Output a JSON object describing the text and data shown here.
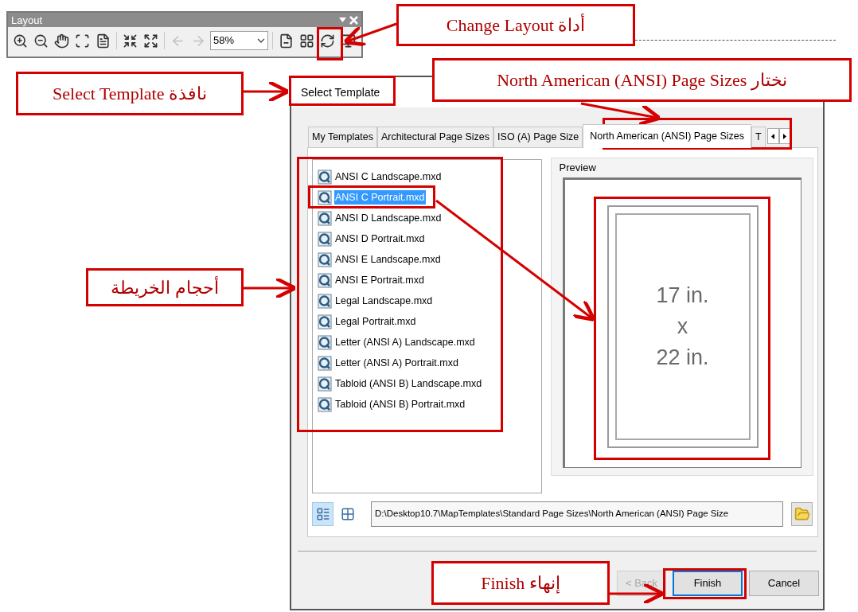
{
  "toolbar": {
    "title": "Layout",
    "zoom": "58%",
    "tool_groups": [
      [
        {
          "disabled": false
        },
        {
          "disabled": false
        },
        {
          "disabled": false
        },
        {
          "disabled": false
        },
        {
          "disabled": false
        }
      ],
      [
        {
          "disabled": false
        },
        {
          "disabled": false
        }
      ],
      [
        {
          "disabled": true
        },
        {
          "disabled": true
        }
      ],
      [
        {
          "disabled": false
        },
        {
          "disabled": false
        },
        {
          "disabled": false
        },
        {
          "disabled": false
        }
      ]
    ]
  },
  "dialog": {
    "title": "Select Template",
    "tabs": [
      {
        "label": "My Templates",
        "selected": false
      },
      {
        "label": "Architectural Page Sizes",
        "selected": false
      },
      {
        "label": "ISO (A) Page Size",
        "selected": false
      },
      {
        "label": "North American (ANSI) Page Sizes",
        "selected": true
      },
      {
        "label": "T",
        "selected": false
      }
    ],
    "templates": [
      {
        "label": "ANSI C Landscape.mxd",
        "selected": false
      },
      {
        "label": "ANSI C Portrait.mxd",
        "selected": true
      },
      {
        "label": "ANSI D Landscape.mxd",
        "selected": false
      },
      {
        "label": "ANSI D Portrait.mxd",
        "selected": false
      },
      {
        "label": "ANSI E Landscape.mxd",
        "selected": false
      },
      {
        "label": "ANSI E Portrait.mxd",
        "selected": false
      },
      {
        "label": "Legal Landscape.mxd",
        "selected": false
      },
      {
        "label": "Legal Portrait.mxd",
        "selected": false
      },
      {
        "label": "Letter (ANSI A) Landscape.mxd",
        "selected": false
      },
      {
        "label": "Letter (ANSI A) Portrait.mxd",
        "selected": false
      },
      {
        "label": "Tabloid (ANSI B) Landscape.mxd",
        "selected": false
      },
      {
        "label": "Tabloid (ANSI B) Portrait.mxd",
        "selected": false
      }
    ],
    "preview": {
      "label": "Preview",
      "lines": [
        "17 in.",
        "x",
        "22 in."
      ]
    },
    "view_modes": [
      {
        "selected": true
      },
      {
        "selected": false
      }
    ],
    "path": "D:\\Desktop10.7\\MapTemplates\\Standard Page Sizes\\North American (ANSI) Page Size",
    "buttons": [
      {
        "label": "< Back",
        "disabled": true,
        "default": false
      },
      {
        "label": "Finish",
        "disabled": false,
        "default": true
      },
      {
        "label": "Cancel",
        "disabled": false,
        "default": false
      }
    ]
  },
  "callouts": [
    "Change Layout أداة",
    "Select Template نافذة",
    "North American (ANSI) Page Sizes نختار",
    "أحجام الخريطة",
    "Finish إنهاء"
  ]
}
